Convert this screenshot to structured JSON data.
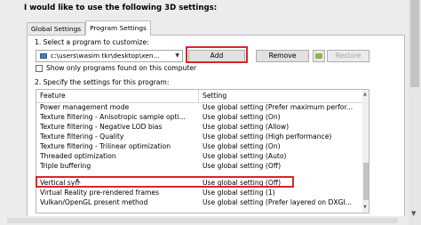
{
  "heading": "I would like to use the following 3D settings:",
  "tabs": [
    {
      "label": "Global Settings",
      "active": false
    },
    {
      "label": "Program Settings",
      "active": true
    }
  ],
  "step1": {
    "label": "1. Select a program to customize:",
    "program_value": "c:\\users\\wasim tkr\\desktop\\xen...",
    "program_icon": "application-icon",
    "add_label": "Add",
    "remove_label": "Remove",
    "restore_label": "Restore",
    "nvidia_icon": "nvidia-icon",
    "checkbox_label": "Show only programs found on this computer",
    "checkbox_checked": false
  },
  "step2": {
    "label": "2. Specify the settings for this program:",
    "columns": [
      "Feature",
      "Setting"
    ],
    "rows": [
      {
        "feature": "Power management mode",
        "setting": "Use global setting (Prefer maximum perfor..."
      },
      {
        "feature": "Texture filtering - Anisotropic sample opti...",
        "setting": "Use global setting (On)"
      },
      {
        "feature": "Texture filtering - Negative LOD bias",
        "setting": "Use global setting (Allow)"
      },
      {
        "feature": "Texture filtering - Quality",
        "setting": "Use global setting (High performance)"
      },
      {
        "feature": "Texture filtering - Trilinear optimization",
        "setting": "Use global setting (On)"
      },
      {
        "feature": "Threaded optimization",
        "setting": "Use global setting (Auto)"
      },
      {
        "feature": "Triple buffering",
        "setting": "Use global setting (Off)"
      },
      {
        "feature": "Vertical syn",
        "setting": "Use global setting (Off)"
      },
      {
        "feature": "Virtual Reality pre-rendered frames",
        "setting": "Use global setting (1)"
      },
      {
        "feature": "Vulkan/OpenGL present method",
        "setting": "Use global setting (Prefer layered on DXGI..."
      }
    ]
  },
  "colors": {
    "highlight": "#d9262a",
    "nvidia_green": "#8ab84a"
  }
}
